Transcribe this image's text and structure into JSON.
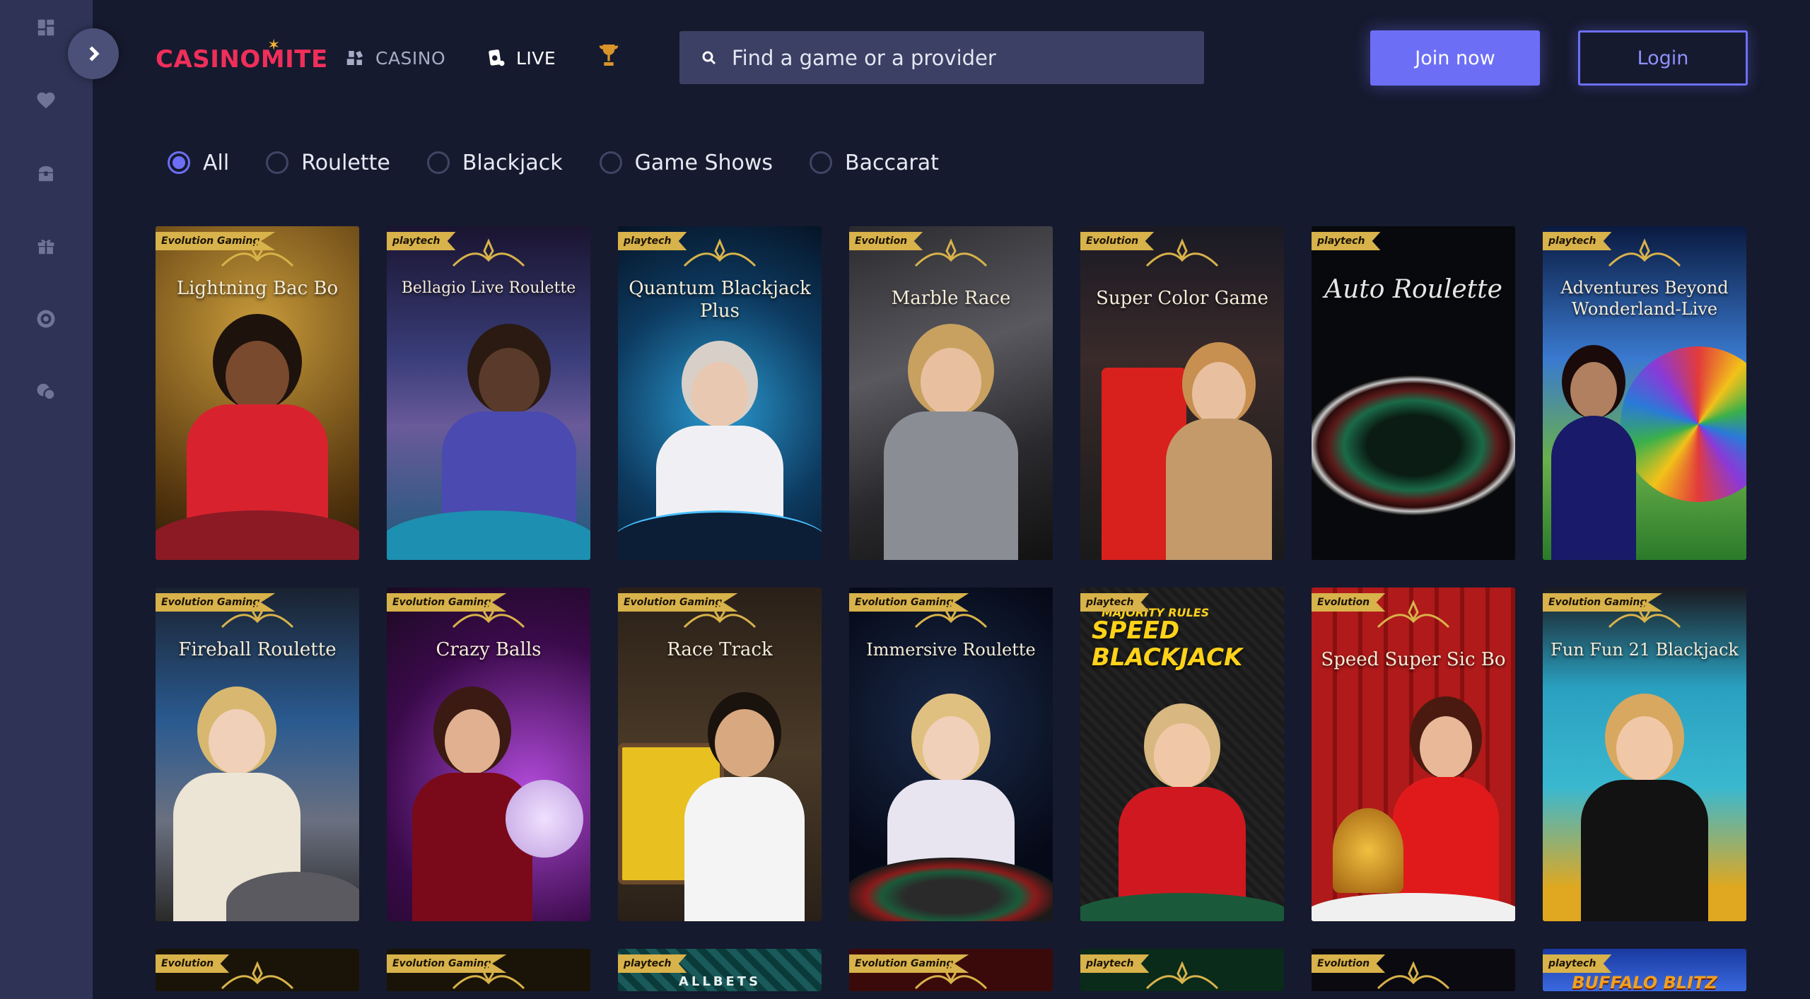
{
  "brand": {
    "logo_text": "CASINOMITE"
  },
  "nav": {
    "casino_label": "CASINO",
    "live_label": "LIVE"
  },
  "search": {
    "placeholder": "Find a game or a provider"
  },
  "auth": {
    "join_label": "Join now",
    "login_label": "Login"
  },
  "filters": [
    {
      "label": "All",
      "checked": true
    },
    {
      "label": "Roulette",
      "checked": false
    },
    {
      "label": "Blackjack",
      "checked": false
    },
    {
      "label": "Game Shows",
      "checked": false
    },
    {
      "label": "Baccarat",
      "checked": false
    }
  ],
  "games_row1": [
    {
      "title": "Lightning Bac Bo",
      "provider": "Evolution Gaming"
    },
    {
      "title": "Bellagio Live Roulette",
      "provider": "playtech"
    },
    {
      "title": "Quantum Blackjack Plus",
      "provider": "playtech"
    },
    {
      "title": "Marble Race",
      "provider": "Evolution"
    },
    {
      "title": "Super Color Game",
      "provider": "Evolution"
    },
    {
      "title": "Auto Roulette",
      "provider": "playtech"
    },
    {
      "title": "Adventures Beyond Wonderland-Live",
      "provider": "playtech"
    }
  ],
  "games_row2": [
    {
      "title": "Fireball Roulette",
      "provider": "Evolution Gaming"
    },
    {
      "title": "Crazy Balls",
      "provider": "Evolution Gaming"
    },
    {
      "title": "Race Track",
      "provider": "Evolution Gaming"
    },
    {
      "title": "Immersive Roulette",
      "provider": "Evolution Gaming"
    },
    {
      "title": "SPEED BLACKJACK",
      "provider": "playtech",
      "subtitle": "MAJORITY RULES"
    },
    {
      "title": "Speed Super Sic Bo",
      "provider": "Evolution"
    },
    {
      "title": "Fun Fun 21 Blackjack",
      "provider": "Evolution Gaming"
    }
  ],
  "games_row3": [
    {
      "provider": "Evolution"
    },
    {
      "provider": "Evolution Gaming"
    },
    {
      "provider": "playtech",
      "title": "ALLBETS"
    },
    {
      "provider": "Evolution Gaming"
    },
    {
      "provider": "playtech"
    },
    {
      "provider": "Evolution"
    },
    {
      "provider": "playtech",
      "title": "BUFFALO BLITZ"
    }
  ],
  "colors": {
    "background": "#161a2e",
    "sidebar": "#2f3457",
    "accent": "#6c6ff6",
    "brand_red": "#ef2f5a",
    "gold": "#d8b24a"
  }
}
